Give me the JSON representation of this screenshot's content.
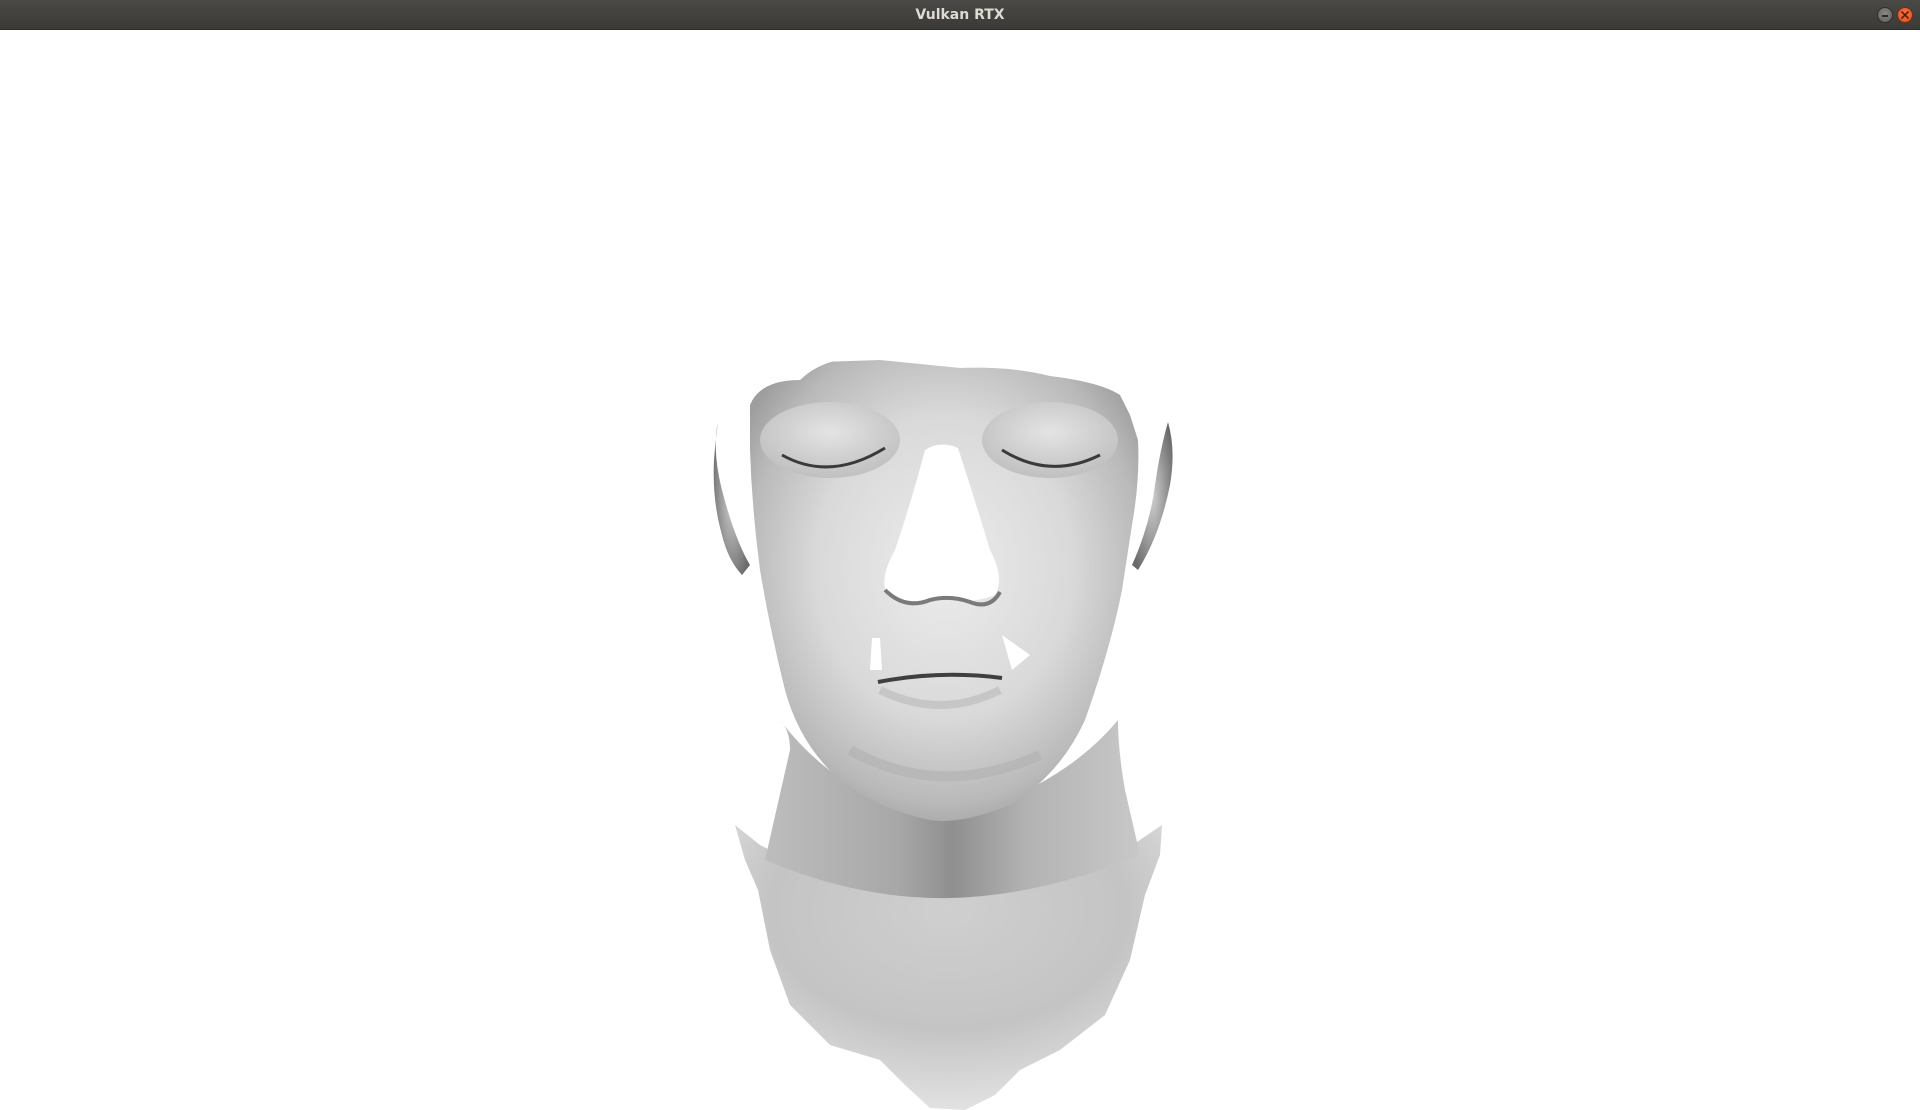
{
  "window": {
    "title": "Vulkan RTX",
    "controls": [
      {
        "name": "minimize",
        "icon": "minimize-icon"
      },
      {
        "name": "close",
        "icon": "close-icon"
      }
    ]
  },
  "viewport": {
    "background": "#ffffff",
    "content": "rendered-head-model"
  }
}
